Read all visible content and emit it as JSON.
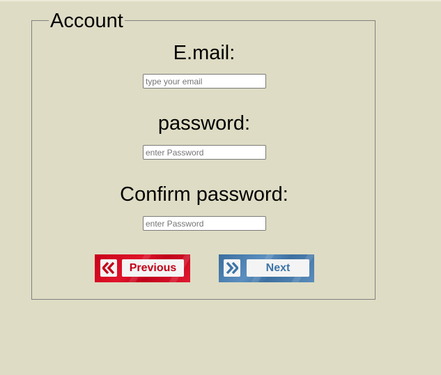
{
  "form": {
    "legend": "Account",
    "email": {
      "label": "E.mail:",
      "placeholder": "type your email",
      "value": ""
    },
    "password": {
      "label": "password:",
      "placeholder": "enter Password",
      "value": ""
    },
    "confirm_password": {
      "label": "Confirm password:",
      "placeholder": "enter Password",
      "value": ""
    }
  },
  "buttons": {
    "previous_label": "Previous",
    "next_label": "Next",
    "previous_icon": "double-chevron-left-icon",
    "next_icon": "double-chevron-right-icon"
  },
  "colors": {
    "background": "#dedcc4",
    "previous_accent": "#c8001a",
    "next_accent": "#3d74a8"
  }
}
